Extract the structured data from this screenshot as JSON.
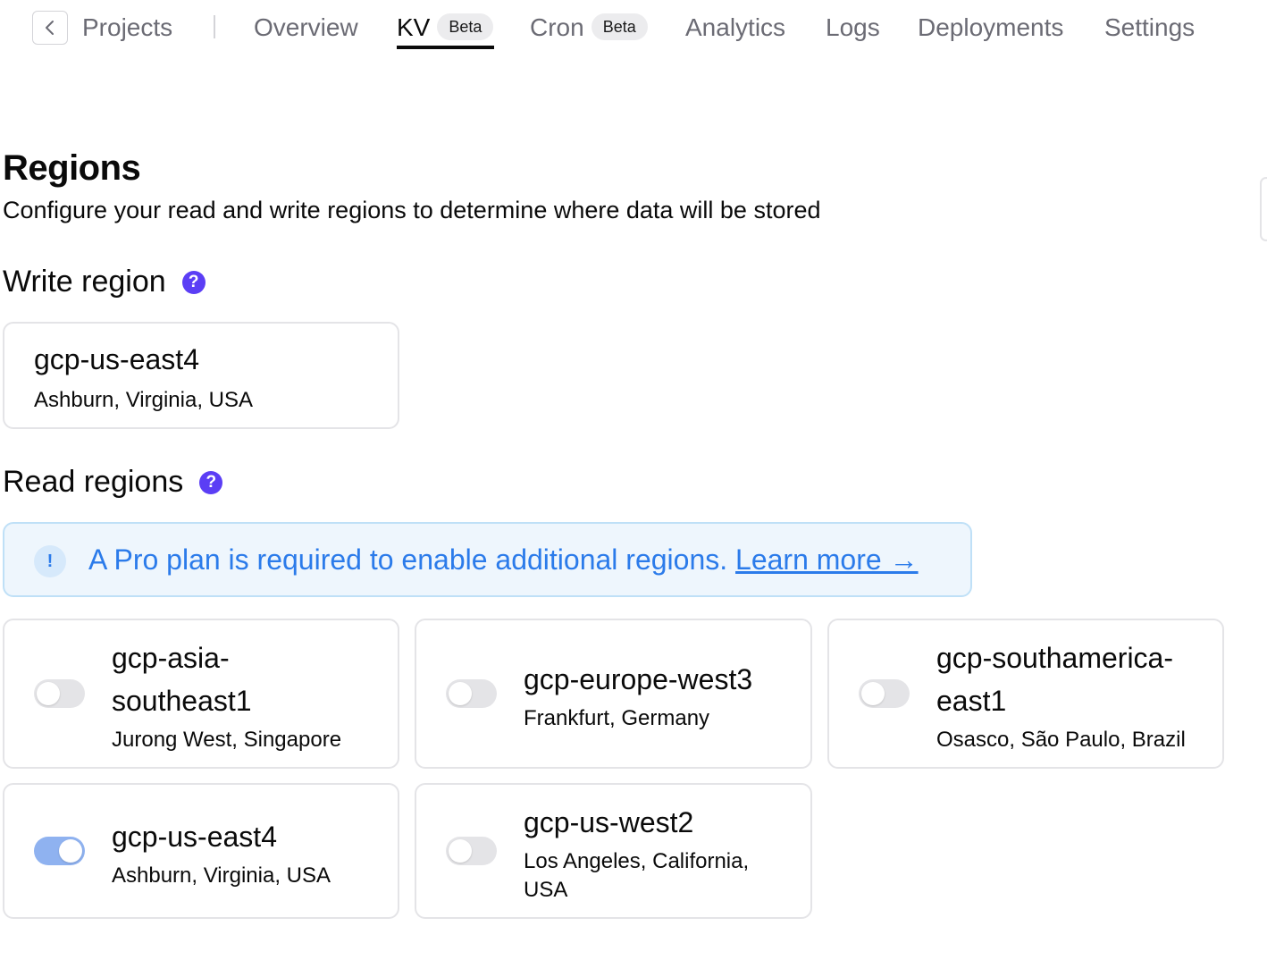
{
  "nav": {
    "projects_label": "Projects",
    "items": [
      {
        "label": "Overview"
      },
      {
        "label": "KV",
        "badge": "Beta",
        "active": true
      },
      {
        "label": "Cron",
        "badge": "Beta"
      },
      {
        "label": "Analytics"
      },
      {
        "label": "Logs"
      },
      {
        "label": "Deployments"
      },
      {
        "label": "Settings"
      }
    ]
  },
  "page": {
    "title": "Regions",
    "subtitle": "Configure your read and write regions to determine where data will be stored"
  },
  "write_region": {
    "heading": "Write region",
    "help_icon": "?",
    "name": "gcp-us-east4",
    "location": "Ashburn, Virginia, USA"
  },
  "read_regions": {
    "heading": "Read regions",
    "help_icon": "?",
    "banner": {
      "icon": "!",
      "message": "A Pro plan is required to enable additional regions.",
      "link": "Learn more →"
    },
    "regions": [
      {
        "name": "gcp-asia-southeast1",
        "name_line1": "gcp-asia-",
        "name_line2": "southeast1",
        "location": "Jurong West, Singapore",
        "enabled": false
      },
      {
        "name": "gcp-europe-west3",
        "location": "Frankfurt, Germany",
        "enabled": false
      },
      {
        "name": "gcp-southamerica-east1",
        "name_line1": "gcp-southamerica-",
        "name_line2": "east1",
        "location": "Osasco, São Paulo, Brazil",
        "enabled": false
      },
      {
        "name": "gcp-us-east4",
        "location": "Ashburn, Virginia, USA",
        "enabled": true
      },
      {
        "name": "gcp-us-west2",
        "location_line1": "Los Angeles, California,",
        "location_line2": "USA",
        "enabled": false
      }
    ]
  },
  "colors": {
    "accent_purple": "#5b3ef5",
    "info_blue": "#2b7bea",
    "toggle_on": "#8fb2f0",
    "toggle_off": "#e4e4e7"
  }
}
